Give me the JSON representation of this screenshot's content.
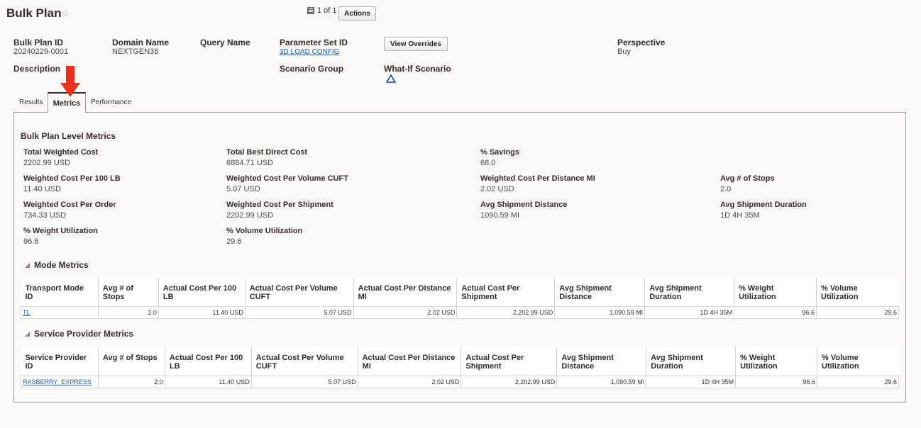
{
  "header": {
    "title": "Bulk Plan",
    "pager": "1 of 1",
    "actions_label": "Actions"
  },
  "details": {
    "bulk_plan_id_label": "Bulk Plan ID",
    "bulk_plan_id": "20240229-0001",
    "domain_name_label": "Domain Name",
    "domain_name": "NEXTGEN38",
    "query_name_label": "Query Name",
    "parameter_set_id_label": "Parameter Set ID",
    "parameter_set_id": "3D LOAD CONFIG",
    "view_overrides_label": "View Overrides",
    "perspective_label": "Perspective",
    "perspective": "Buy",
    "description_label": "Description",
    "scenario_group_label": "Scenario Group",
    "what_if_label": "What-If Scenario"
  },
  "tabs": [
    "Results",
    "Metrics",
    "Performance"
  ],
  "bulk_metrics": {
    "title": "Bulk Plan Level Metrics",
    "items": [
      {
        "label": "Total Weighted Cost",
        "value": "2202.99 USD"
      },
      {
        "label": "Total Best Direct Cost",
        "value": "6884.71 USD"
      },
      {
        "label": "% Savings",
        "value": "68.0"
      },
      {
        "label": "Weighted Cost Per 100 LB",
        "value": "11.40 USD"
      },
      {
        "label": "Weighted Cost Per Volume CUFT",
        "value": "5.07 USD"
      },
      {
        "label": "Weighted Cost Per Distance MI",
        "value": "2.02 USD"
      },
      {
        "label": "Avg # of Stops",
        "value": "2.0"
      },
      {
        "label": "Weighted Cost Per Order",
        "value": "734.33 USD"
      },
      {
        "label": "Weighted Cost Per Shipment",
        "value": "2202.99 USD"
      },
      {
        "label": "Avg Shipment Distance",
        "value": "1090.59 MI"
      },
      {
        "label": "Avg Shipment Duration",
        "value": "1D 4H 35M"
      },
      {
        "label": "% Weight Utilization",
        "value": "96.6"
      },
      {
        "label": "% Volume Utilization",
        "value": "29.6"
      }
    ]
  },
  "mode_metrics": {
    "title": "Mode Metrics",
    "headers": [
      "Transport Mode ID",
      "Avg # of Stops",
      "Actual Cost Per 100 LB",
      "Actual Cost Per Volume CUFT",
      "Actual Cost Per Distance MI",
      "Actual Cost Per Shipment",
      "Avg Shipment Distance",
      "Avg Shipment Duration",
      "% Weight Utilization",
      "% Volume Utilization"
    ],
    "rows": [
      [
        "TL",
        "2.0",
        "11.40 USD",
        "5.07 USD",
        "2.02 USD",
        "2,202.99 USD",
        "1,090.59 MI",
        "1D 4H 35M",
        "96.6",
        "29.6"
      ]
    ]
  },
  "sp_metrics": {
    "title": "Service Provider Metrics",
    "headers": [
      "Service Provider ID",
      "Avg # of Stops",
      "Actual Cost Per 100 LB",
      "Actual Cost Per Volume CUFT",
      "Actual Cost Per Distance MI",
      "Actual Cost Per Shipment",
      "Avg Shipment Distance",
      "Avg Shipment Duration",
      "% Weight Utilization",
      "% Volume Utilization"
    ],
    "rows": [
      [
        "RASBERRY_EXPRESS",
        "2.0",
        "11.40 USD",
        "5.07 USD",
        "2.02 USD",
        "2,202.99 USD",
        "1,090.59 MI",
        "1D 4H 35M",
        "96.6",
        "29.6"
      ]
    ]
  },
  "colors": {
    "link": "#1b5fa9",
    "arrow": "#e8321e",
    "border": "#a19d98"
  },
  "icons": [
    "star-icon",
    "pager-icon",
    "warning-triangle-icon",
    "collapse-icon",
    "red-arrow-annotation"
  ]
}
